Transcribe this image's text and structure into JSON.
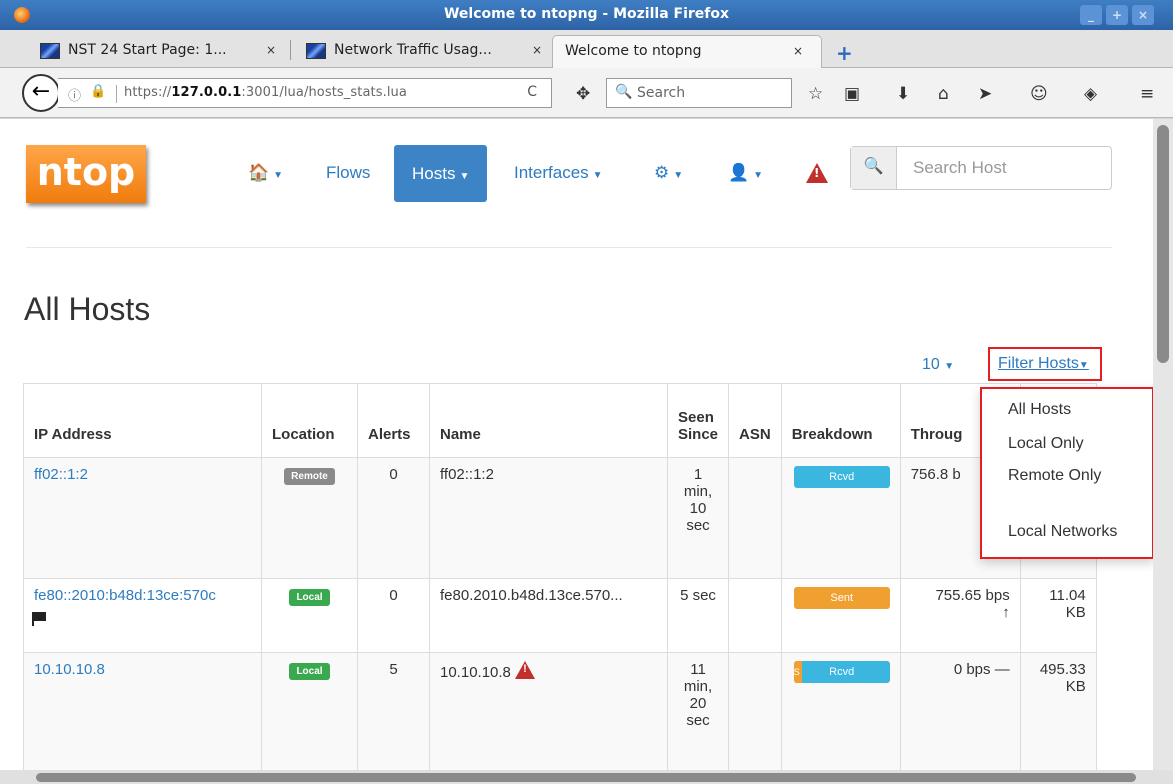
{
  "window": {
    "title": "Welcome to ntopng - Mozilla Firefox",
    "controls": [
      "_",
      "+",
      "×"
    ]
  },
  "tabs": [
    {
      "label": "NST 24 Start Page: 1...",
      "close": "×"
    },
    {
      "label": "Network Traffic Usag...",
      "close": "×"
    },
    {
      "label": "Welcome to ntopng",
      "close": "×"
    }
  ],
  "nav": {
    "back": "←",
    "info_icon": "ⓘ",
    "lock_icon": "🔒",
    "url_prefix": "https://",
    "url_host": "127.0.0.1",
    "url_rest": ":3001/lua/hosts_stats.lua",
    "reload": "C",
    "search_placeholder": "Search",
    "search_icon": "🔍",
    "icons": [
      "☆",
      "▣",
      "⬇",
      "⌂",
      "➤",
      "☺",
      "◈",
      "≡"
    ]
  },
  "ntop": {
    "logo": "ntop",
    "menu": {
      "home": "🏠",
      "flows": "Flows",
      "hosts": "Hosts",
      "interfaces": "Interfaces",
      "settings": "⚙",
      "user": "👤",
      "alert": "!"
    },
    "search_placeholder": "Search Host",
    "search_icon": "🔍"
  },
  "page": {
    "title": "All Hosts",
    "per_page": "10",
    "filter_label": "Filter Hosts",
    "filter_options": [
      "All Hosts",
      "Local Only",
      "Remote Only",
      "Local Networks"
    ]
  },
  "table": {
    "headers": {
      "ip": "IP Address",
      "location": "Location",
      "alerts": "Alerts",
      "name": "Name",
      "seen_since_1": "Seen",
      "seen_since_2": "Since",
      "asn": "ASN",
      "breakdown": "Breakdown",
      "throughput": "Throug"
    },
    "rows": [
      {
        "ip": "ff02::1:2",
        "location": "Remote",
        "alerts": "0",
        "name": "ff02::1:2",
        "seen": [
          "1",
          "min,",
          "10",
          "sec"
        ],
        "asn": "",
        "breakdown": "Rcvd",
        "throughput": "756.8 b",
        "traffic": ""
      },
      {
        "ip": "fe80::2010:b48d:13ce:570c",
        "location": "Local",
        "alerts": "0",
        "name": "fe80.2010.b48d.13ce.570...",
        "seen": [
          "5 sec"
        ],
        "asn": "",
        "breakdown": "Sent",
        "throughput": "755.65 bps",
        "throughput_trend": "↑",
        "traffic": [
          "11.04",
          "KB"
        ]
      },
      {
        "ip": "10.10.10.8",
        "location": "Local",
        "alerts": "5",
        "name": "10.10.10.8",
        "seen": [
          "11",
          "min,",
          "20",
          "sec"
        ],
        "asn": "",
        "breakdown_small": "S",
        "breakdown": "Rcvd",
        "throughput": "0 bps",
        "throughput_trend": "—",
        "traffic": [
          "495.33",
          "KB"
        ]
      }
    ]
  },
  "colors": {
    "brand_orange": "#f07c0c",
    "link_blue": "#2d7bc1",
    "active_blue": "#3d84c6",
    "alert_red": "#c2302e",
    "remote_gray": "#8a8a8a",
    "local_green": "#3aa84f",
    "rcvd_cyan": "#3bb6df",
    "sent_orange": "#f0a030",
    "highlight_red": "#e41e20"
  }
}
